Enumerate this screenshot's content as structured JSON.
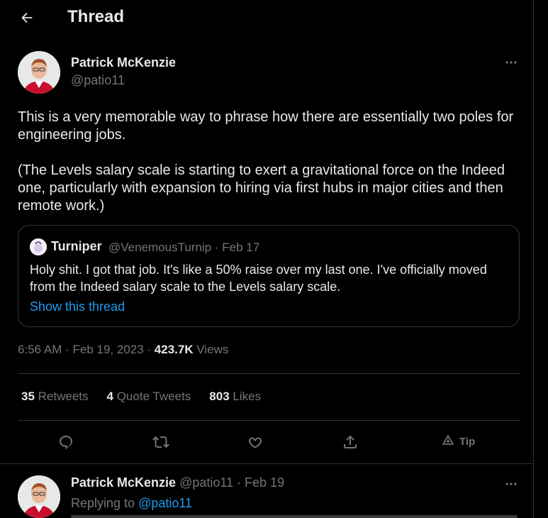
{
  "header": {
    "title": "Thread",
    "back_icon": "arrow-left-icon"
  },
  "tweet": {
    "author_name": "Patrick McKenzie",
    "author_handle": "@patio11",
    "paragraph1": "This is a very memorable way to phrase how there are essentially two poles for engineering jobs.",
    "paragraph2": "(The Levels salary scale is starting to exert a gravitational force on the Indeed one, particularly with expansion to hiring via first hubs in major cities and then remote work.)",
    "timestamp": "6:56 AM · Feb 19, 2023 · ",
    "views_count": "423.7K",
    "views_label": " Views"
  },
  "quote": {
    "author_name": "Turniper",
    "meta": "@VenemousTurnip · Feb 17",
    "text": "Holy shit. I got that job. It's like a 50% raise over my last one. I've officially moved from the Indeed salary scale to the Levels salary scale.",
    "link": "Show this thread"
  },
  "stats": {
    "retweets_count": "35",
    "retweets_label": " Retweets",
    "quotes_count": "4",
    "quotes_label": " Quote Tweets",
    "likes_count": "803",
    "likes_label": " Likes"
  },
  "actions": {
    "reply_icon": "reply-icon",
    "retweet_icon": "retweet-icon",
    "like_icon": "heart-icon",
    "share_icon": "share-icon",
    "tip_label": "Tip"
  },
  "reply": {
    "author_name": "Patrick McKenzie",
    "meta": " @patio11 · Feb 19",
    "replying_prefix": "Replying to ",
    "replying_to": "@patio11"
  },
  "colors": {
    "background": "#000000",
    "text": "#e7e9ea",
    "secondary": "#71767b",
    "accent": "#1d9bf0",
    "border": "#2f3336"
  }
}
